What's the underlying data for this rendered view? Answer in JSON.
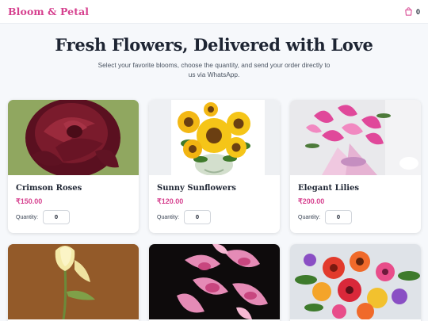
{
  "navbar": {
    "brand": "Bloom & Petal",
    "cart_count": "0",
    "cart_icon": "shopping-bag-icon"
  },
  "hero": {
    "title": "Fresh Flowers, Delivered with Love",
    "subtitle": "Select your favorite blooms, choose the quantity, and send your order directly to us via WhatsApp."
  },
  "colors": {
    "accent": "#d6418f",
    "background": "#f6f8fb",
    "title": "#1e2533"
  },
  "products": [
    {
      "name": "Crimson Roses",
      "price": "₹150.00",
      "quantity_label": "Quantity:",
      "quantity": "0"
    },
    {
      "name": "Sunny Sunflowers",
      "price": "₹120.00",
      "quantity_label": "Quantity:",
      "quantity": "0"
    },
    {
      "name": "Elegant Lilies",
      "price": "₹200.00",
      "quantity_label": "Quantity:",
      "quantity": "0"
    }
  ]
}
